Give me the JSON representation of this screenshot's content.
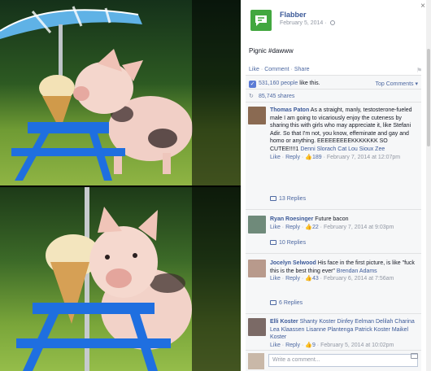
{
  "post": {
    "page_name": "Flabber",
    "date": "February 5, 2014 · ",
    "text": "Pignic #dawww"
  },
  "actions": {
    "like": "Like",
    "comment": "Comment",
    "share": "Share",
    "sep": "·"
  },
  "stats": {
    "likes_count": "531,160 people",
    "likes_suffix": " like this.",
    "top_comments": "Top Comments ▾",
    "shares": "85,745 shares"
  },
  "comments": [
    {
      "author": "Thomas Paton",
      "text": " As a straight, manly, testosterone-fueled male I am going to vicariously enjoy the cuteness by sharing this with girls who may appreciate it, like Stefani Adir. So that I'm not, you know, effeminate and gay and homo or anything. EEEEEEEEEKKKKKKK SO CUTEE!!!!1 ",
      "mentions": "Denni Slorach Cat Lou Sioux Zee",
      "like": "Like",
      "reply": "Reply",
      "likes": "189",
      "date": "February 7, 2014 at 12:07pm",
      "replies": "13 Replies"
    },
    {
      "author": "Ryan Roesinger",
      "text": " Future bacon",
      "mentions": "",
      "like": "Like",
      "reply": "Reply",
      "likes": "22",
      "date": "February 7, 2014 at 9:03pm",
      "replies": "10 Replies"
    },
    {
      "author": "Jocelyn Selwood",
      "text": " His face in the first picture, is like \"fuck this is the best thing ever\" ",
      "mentions": "Brendan Adams",
      "like": "Like",
      "reply": "Reply",
      "likes": "43",
      "date": "February 6, 2014 at 7:56am",
      "replies": "6 Replies"
    },
    {
      "author": "Elli Koster",
      "text": " ",
      "mentions": "Shanty Koster Dinfey Eelman Delilah Charina Lea Klaassen Lisanne Plantenga Patrick Koster Maikel Koster",
      "like": "Like",
      "reply": "Reply",
      "likes": "9",
      "date": "February 5, 2014 at 10:02pm",
      "replies": ""
    }
  ],
  "composer": {
    "placeholder": "Write a comment..."
  },
  "icons": {
    "close": "×",
    "like": "👍",
    "share": "↻",
    "flag": "⚑",
    "page_logo": "speech-bubble-icon"
  },
  "colors": {
    "link": "#3b5998",
    "brand_green": "#42a73f",
    "umbrella": "#5fb2e6",
    "table": "#1f6fe0"
  }
}
